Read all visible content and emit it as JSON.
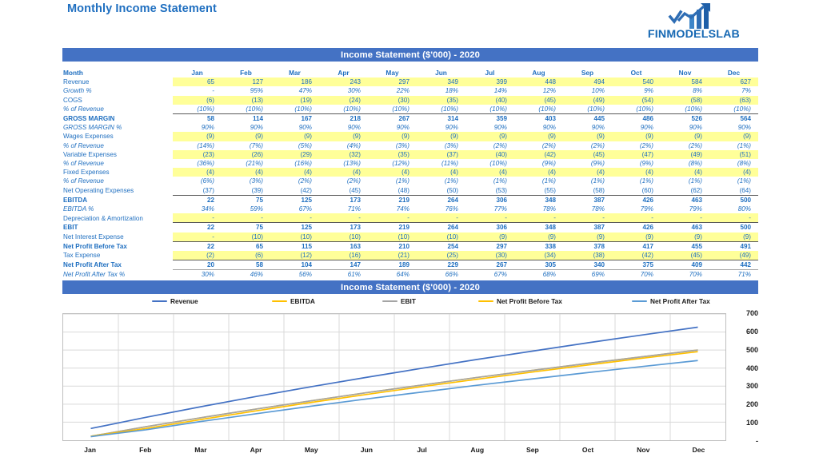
{
  "header": {
    "doc_title": "Monthly Income Statement",
    "logo_text": "FINMODELSLAB",
    "logo_icon": "bar-chart-arrow-up-icon"
  },
  "table_section": {
    "bar_title": "Income Statement ($'000) - 2020",
    "label_header": "Month",
    "months": [
      "Jan",
      "Feb",
      "Mar",
      "Apr",
      "May",
      "Jun",
      "Jul",
      "Aug",
      "Sep",
      "Oct",
      "Nov",
      "Dec"
    ],
    "rows": [
      {
        "label": "Revenue",
        "style": "plain-bold-no",
        "bold": false,
        "italic": false,
        "yellow": true,
        "rule": "",
        "values": [
          "65",
          "127",
          "186",
          "243",
          "297",
          "349",
          "399",
          "448",
          "494",
          "540",
          "584",
          "627"
        ]
      },
      {
        "label": "Growth %",
        "bold": false,
        "italic": true,
        "yellow": false,
        "rule": "",
        "values": [
          "-",
          "95%",
          "47%",
          "30%",
          "22%",
          "18%",
          "14%",
          "12%",
          "10%",
          "9%",
          "8%",
          "7%"
        ]
      },
      {
        "label": "COGS",
        "bold": false,
        "italic": false,
        "yellow": true,
        "rule": "",
        "values": [
          "(6)",
          "(13)",
          "(19)",
          "(24)",
          "(30)",
          "(35)",
          "(40)",
          "(45)",
          "(49)",
          "(54)",
          "(58)",
          "(63)"
        ]
      },
      {
        "label": "% of Revenue",
        "bold": false,
        "italic": true,
        "yellow": false,
        "rule": "",
        "values": [
          "(10%)",
          "(10%)",
          "(10%)",
          "(10%)",
          "(10%)",
          "(10%)",
          "(10%)",
          "(10%)",
          "(10%)",
          "(10%)",
          "(10%)",
          "(10%)"
        ]
      },
      {
        "label": "GROSS MARGIN",
        "bold": true,
        "italic": false,
        "yellow": false,
        "rule": "topline",
        "values": [
          "58",
          "114",
          "167",
          "218",
          "267",
          "314",
          "359",
          "403",
          "445",
          "486",
          "526",
          "564"
        ]
      },
      {
        "label": "GROSS MARGIN %",
        "bold": false,
        "italic": true,
        "yellow": false,
        "rule": "",
        "values": [
          "90%",
          "90%",
          "90%",
          "90%",
          "90%",
          "90%",
          "90%",
          "90%",
          "90%",
          "90%",
          "90%",
          "90%"
        ]
      },
      {
        "label": "Wages Expenses",
        "bold": false,
        "italic": false,
        "yellow": true,
        "rule": "",
        "values": [
          "(9)",
          "(9)",
          "(9)",
          "(9)",
          "(9)",
          "(9)",
          "(9)",
          "(9)",
          "(9)",
          "(9)",
          "(9)",
          "(9)"
        ]
      },
      {
        "label": "% of Revenue",
        "bold": false,
        "italic": true,
        "yellow": false,
        "rule": "",
        "values": [
          "(14%)",
          "(7%)",
          "(5%)",
          "(4%)",
          "(3%)",
          "(3%)",
          "(2%)",
          "(2%)",
          "(2%)",
          "(2%)",
          "(2%)",
          "(1%)"
        ]
      },
      {
        "label": "Variable Expenses",
        "bold": false,
        "italic": false,
        "yellow": true,
        "rule": "",
        "values": [
          "(23)",
          "(26)",
          "(29)",
          "(32)",
          "(35)",
          "(37)",
          "(40)",
          "(42)",
          "(45)",
          "(47)",
          "(49)",
          "(51)"
        ]
      },
      {
        "label": "% of Revenue",
        "bold": false,
        "italic": true,
        "yellow": false,
        "rule": "",
        "values": [
          "(36%)",
          "(21%)",
          "(16%)",
          "(13%)",
          "(12%)",
          "(11%)",
          "(10%)",
          "(9%)",
          "(9%)",
          "(9%)",
          "(8%)",
          "(8%)"
        ]
      },
      {
        "label": "Fixed Expenses",
        "bold": false,
        "italic": false,
        "yellow": true,
        "rule": "",
        "values": [
          "(4)",
          "(4)",
          "(4)",
          "(4)",
          "(4)",
          "(4)",
          "(4)",
          "(4)",
          "(4)",
          "(4)",
          "(4)",
          "(4)"
        ]
      },
      {
        "label": "% of Revenue",
        "bold": false,
        "italic": true,
        "yellow": false,
        "rule": "",
        "values": [
          "(6%)",
          "(3%)",
          "(2%)",
          "(2%)",
          "(1%)",
          "(1%)",
          "(1%)",
          "(1%)",
          "(1%)",
          "(1%)",
          "(1%)",
          "(1%)"
        ]
      },
      {
        "label": "Net Operating Expenses",
        "bold": false,
        "italic": false,
        "yellow": false,
        "rule": "",
        "values": [
          "(37)",
          "(39)",
          "(42)",
          "(45)",
          "(48)",
          "(50)",
          "(53)",
          "(55)",
          "(58)",
          "(60)",
          "(62)",
          "(64)"
        ]
      },
      {
        "label": "EBITDA",
        "bold": true,
        "italic": false,
        "yellow": false,
        "rule": "topline",
        "values": [
          "22",
          "75",
          "125",
          "173",
          "219",
          "264",
          "306",
          "348",
          "387",
          "426",
          "463",
          "500"
        ]
      },
      {
        "label": "EBITDA %",
        "bold": false,
        "italic": true,
        "yellow": false,
        "rule": "",
        "values": [
          "34%",
          "59%",
          "67%",
          "71%",
          "74%",
          "76%",
          "77%",
          "78%",
          "78%",
          "79%",
          "79%",
          "80%"
        ]
      },
      {
        "label": "Depreciation & Amortization",
        "bold": false,
        "italic": false,
        "yellow": true,
        "rule": "",
        "values": [
          "-",
          "-",
          "-",
          "-",
          "-",
          "-",
          "-",
          "-",
          "-",
          "-",
          "-",
          "-"
        ]
      },
      {
        "label": "EBIT",
        "bold": true,
        "italic": false,
        "yellow": false,
        "rule": "topline",
        "values": [
          "22",
          "75",
          "125",
          "173",
          "219",
          "264",
          "306",
          "348",
          "387",
          "426",
          "463",
          "500"
        ]
      },
      {
        "label": "Net Interest Expense",
        "bold": false,
        "italic": false,
        "yellow": true,
        "rule": "",
        "values": [
          "-",
          "(10)",
          "(10)",
          "(10)",
          "(10)",
          "(10)",
          "(9)",
          "(9)",
          "(9)",
          "(9)",
          "(9)",
          "(9)"
        ]
      },
      {
        "label": "Net Profit Before Tax",
        "bold": true,
        "italic": false,
        "yellow": false,
        "rule": "topline",
        "values": [
          "22",
          "65",
          "115",
          "163",
          "210",
          "254",
          "297",
          "338",
          "378",
          "417",
          "455",
          "491"
        ]
      },
      {
        "label": "Tax Expense",
        "bold": false,
        "italic": false,
        "yellow": true,
        "rule": "",
        "values": [
          "(2)",
          "(6)",
          "(12)",
          "(16)",
          "(21)",
          "(25)",
          "(30)",
          "(34)",
          "(38)",
          "(42)",
          "(45)",
          "(49)"
        ]
      },
      {
        "label": "Net Profit After Tax",
        "bold": true,
        "italic": false,
        "yellow": false,
        "rule": "bothline",
        "values": [
          "20",
          "58",
          "104",
          "147",
          "189",
          "229",
          "267",
          "305",
          "340",
          "375",
          "409",
          "442"
        ]
      },
      {
        "label": "Net Profit After Tax %",
        "bold": false,
        "italic": true,
        "yellow": false,
        "rule": "",
        "values": [
          "30%",
          "46%",
          "56%",
          "61%",
          "64%",
          "66%",
          "67%",
          "68%",
          "69%",
          "70%",
          "70%",
          "71%"
        ]
      }
    ]
  },
  "chart_section": {
    "bar_title": "Income Statement ($'000) - 2020"
  },
  "chart_data": {
    "type": "line",
    "title": "Income Statement ($'000) - 2020",
    "xlabel": "",
    "ylabel": "",
    "categories": [
      "Jan",
      "Feb",
      "Mar",
      "Apr",
      "May",
      "Jun",
      "Jul",
      "Aug",
      "Sep",
      "Oct",
      "Nov",
      "Dec"
    ],
    "ylim": [
      0,
      700
    ],
    "yticks": [
      "-",
      "100",
      "200",
      "300",
      "400",
      "500",
      "600",
      "700"
    ],
    "ytick_values": [
      0,
      100,
      200,
      300,
      400,
      500,
      600,
      700
    ],
    "grid": true,
    "legend_position": "top",
    "series": [
      {
        "name": "Revenue",
        "color": "#4472C4",
        "values": [
          65,
          127,
          186,
          243,
          297,
          349,
          399,
          448,
          494,
          540,
          584,
          627
        ]
      },
      {
        "name": "EBITDA",
        "color": "#FFC000",
        "values": [
          22,
          75,
          125,
          173,
          219,
          264,
          306,
          348,
          387,
          426,
          463,
          500
        ]
      },
      {
        "name": "EBIT",
        "color": "#A5A5A5",
        "values": [
          22,
          75,
          125,
          173,
          219,
          264,
          306,
          348,
          387,
          426,
          463,
          500
        ]
      },
      {
        "name": "Net Profit Before Tax",
        "color": "#FFC000",
        "values": [
          22,
          65,
          115,
          163,
          210,
          254,
          297,
          338,
          378,
          417,
          455,
          491
        ]
      },
      {
        "name": "Net Profit After Tax",
        "color": "#5B9BD5",
        "values": [
          20,
          58,
          104,
          147,
          189,
          229,
          267,
          305,
          340,
          375,
          409,
          442
        ]
      }
    ]
  },
  "colors": {
    "brand_blue": "#1F6FC0",
    "bar_blue": "#4472C4",
    "highlight_yellow": "#FFFF99",
    "logo_blue": "#1668B3"
  }
}
